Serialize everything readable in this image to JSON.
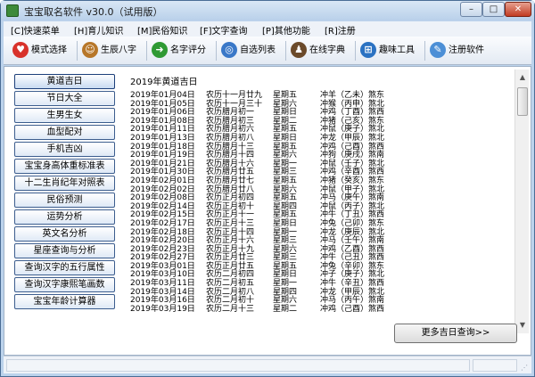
{
  "window": {
    "title": "宝宝取名软件 v30.0（试用版）",
    "controls": {
      "minimize": "–",
      "maximize": "□",
      "close": "✕"
    }
  },
  "menu": [
    {
      "label": "[C]快速菜单"
    },
    {
      "label": "[H]育儿知识"
    },
    {
      "label": "[M]民俗知识"
    },
    {
      "label": "[F]文字查询"
    },
    {
      "label": "[P]其他功能"
    },
    {
      "label": "[R]注册"
    }
  ],
  "toolbar": [
    {
      "label": "模式选择",
      "icon": "heart-icon",
      "color": "#d8322b",
      "glyph": "♥"
    },
    {
      "label": "生辰八字",
      "icon": "people-icon",
      "color": "#b7772a",
      "glyph": "☺"
    },
    {
      "label": "名字评分",
      "icon": "arrow-right-icon",
      "color": "#2f9a34",
      "glyph": "➜"
    },
    {
      "label": "自选列表",
      "icon": "globe-icon",
      "color": "#3a78c8",
      "glyph": "◎"
    },
    {
      "label": "在线字典",
      "icon": "scholar-icon",
      "color": "#6b4a2a",
      "glyph": "♟"
    },
    {
      "label": "趣味工具",
      "icon": "windows-logo-icon",
      "color": "#2b72c2",
      "glyph": "⊞"
    },
    {
      "label": "注册软件",
      "icon": "register-icon",
      "color": "#4c8fd6",
      "glyph": "✎"
    }
  ],
  "sidebar": [
    {
      "label": "黄道吉日",
      "active": true
    },
    {
      "label": "节日大全"
    },
    {
      "label": "生男生女"
    },
    {
      "label": "血型配对"
    },
    {
      "label": "手机吉凶"
    },
    {
      "label": "宝宝身高体重标准表"
    },
    {
      "label": "十二生肖纪年对照表"
    },
    {
      "label": "民俗预测"
    },
    {
      "label": "运势分析"
    },
    {
      "label": "英文名分析"
    },
    {
      "label": "星座查询与分析"
    },
    {
      "label": "查询汉字的五行属性"
    },
    {
      "label": "查询汉字康熙笔画数"
    },
    {
      "label": "宝宝年龄计算器"
    }
  ],
  "content": {
    "title": "2019年黄道吉日",
    "rows": [
      {
        "date": "2019年01月04日",
        "lunar": "农历十一月廿九",
        "week": "星期五",
        "ch": "冲羊（乙未）煞东"
      },
      {
        "date": "2019年01月05日",
        "lunar": "农历十一月三十",
        "week": "星期六",
        "ch": "冲猴（丙申）煞北"
      },
      {
        "date": "2019年01月06日",
        "lunar": "农历腊月初一",
        "week": "星期日",
        "ch": "冲鸡（丁酉）煞西"
      },
      {
        "date": "2019年01月08日",
        "lunar": "农历腊月初三",
        "week": "星期二",
        "ch": "冲猪（己亥）煞东"
      },
      {
        "date": "2019年01月11日",
        "lunar": "农历腊月初六",
        "week": "星期五",
        "ch": "冲鼠（庚子）煞北"
      },
      {
        "date": "2019年01月13日",
        "lunar": "农历腊月初八",
        "week": "星期日",
        "ch": "冲龙（甲辰）煞北"
      },
      {
        "date": "2019年01月18日",
        "lunar": "农历腊月十三",
        "week": "星期五",
        "ch": "冲鸡（己酉）煞西"
      },
      {
        "date": "2019年01月19日",
        "lunar": "农历腊月十四",
        "week": "星期六",
        "ch": "冲狗（庚戌）煞南"
      },
      {
        "date": "2019年01月21日",
        "lunar": "农历腊月十六",
        "week": "星期一",
        "ch": "冲鼠（壬子）煞北"
      },
      {
        "date": "2019年01月30日",
        "lunar": "农历腊月廿五",
        "week": "星期三",
        "ch": "冲鸡（辛酉）煞西"
      },
      {
        "date": "2019年02月01日",
        "lunar": "农历腊月廿七",
        "week": "星期五",
        "ch": "冲猪（癸亥）煞东"
      },
      {
        "date": "2019年02月02日",
        "lunar": "农历腊月廿八",
        "week": "星期六",
        "ch": "冲鼠（甲子）煞北"
      },
      {
        "date": "2019年02月08日",
        "lunar": "农历正月初四",
        "week": "星期五",
        "ch": "冲马（庚午）煞南"
      },
      {
        "date": "2019年02月14日",
        "lunar": "农历正月初十",
        "week": "星期四",
        "ch": "冲鼠（丙子）煞北"
      },
      {
        "date": "2019年02月15日",
        "lunar": "农历正月十一",
        "week": "星期五",
        "ch": "冲牛（丁丑）煞西"
      },
      {
        "date": "2019年02月17日",
        "lunar": "农历正月十三",
        "week": "星期日",
        "ch": "冲兔（己卯）煞东"
      },
      {
        "date": "2019年02月18日",
        "lunar": "农历正月十四",
        "week": "星期一",
        "ch": "冲龙（庚辰）煞北"
      },
      {
        "date": "2019年02月20日",
        "lunar": "农历正月十六",
        "week": "星期三",
        "ch": "冲马（壬午）煞南"
      },
      {
        "date": "2019年02月23日",
        "lunar": "农历正月十九",
        "week": "星期六",
        "ch": "冲鸡（乙酉）煞西"
      },
      {
        "date": "2019年02月27日",
        "lunar": "农历正月廿三",
        "week": "星期三",
        "ch": "冲牛（己丑）煞西"
      },
      {
        "date": "2019年03月01日",
        "lunar": "农历正月廿五",
        "week": "星期五",
        "ch": "冲兔（辛卯）煞东"
      },
      {
        "date": "2019年03月10日",
        "lunar": "农历二月初四",
        "week": "星期日",
        "ch": "冲子（庚子）煞北"
      },
      {
        "date": "2019年03月11日",
        "lunar": "农历二月初五",
        "week": "星期一",
        "ch": "冲牛（辛丑）煞西"
      },
      {
        "date": "2019年03月14日",
        "lunar": "农历二月初八",
        "week": "星期四",
        "ch": "冲龙（甲辰）煞北"
      },
      {
        "date": "2019年03月16日",
        "lunar": "农历二月初十",
        "week": "星期六",
        "ch": "冲马（丙午）煞南"
      },
      {
        "date": "2019年03月19日",
        "lunar": "农历二月十三",
        "week": "星期二",
        "ch": "冲鸡（己酉）煞西"
      }
    ]
  },
  "more_button": "更多吉日查询>>"
}
